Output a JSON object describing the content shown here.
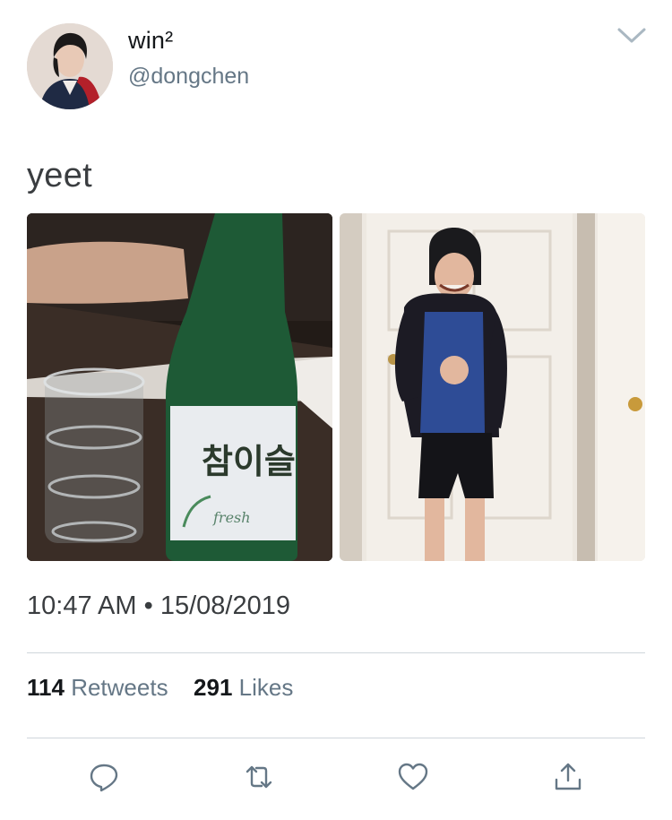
{
  "tweet": {
    "author": {
      "display_name": "win²",
      "handle": "@dongchen"
    },
    "text": "yeet",
    "media": [
      {
        "description": "soju bottle and shot glasses"
      },
      {
        "description": "kid in hoodie pointing"
      }
    ],
    "time": "10:47 AM",
    "separator": "•",
    "date": "15/08/2019",
    "retweets": {
      "count": "114",
      "label": "Retweets"
    },
    "likes": {
      "count": "291",
      "label": "Likes"
    },
    "bottle_label": {
      "brand": "참이슬",
      "variant": "fresh"
    }
  },
  "actions": [
    {
      "name": "reply",
      "icon": "reply-icon"
    },
    {
      "name": "retweet",
      "icon": "retweet-icon"
    },
    {
      "name": "like",
      "icon": "heart-icon"
    },
    {
      "name": "share",
      "icon": "share-icon"
    }
  ],
  "colors": {
    "text_primary": "#14171a",
    "text_secondary": "#657786",
    "divider": "#cfd6db",
    "icon": "#657786"
  }
}
